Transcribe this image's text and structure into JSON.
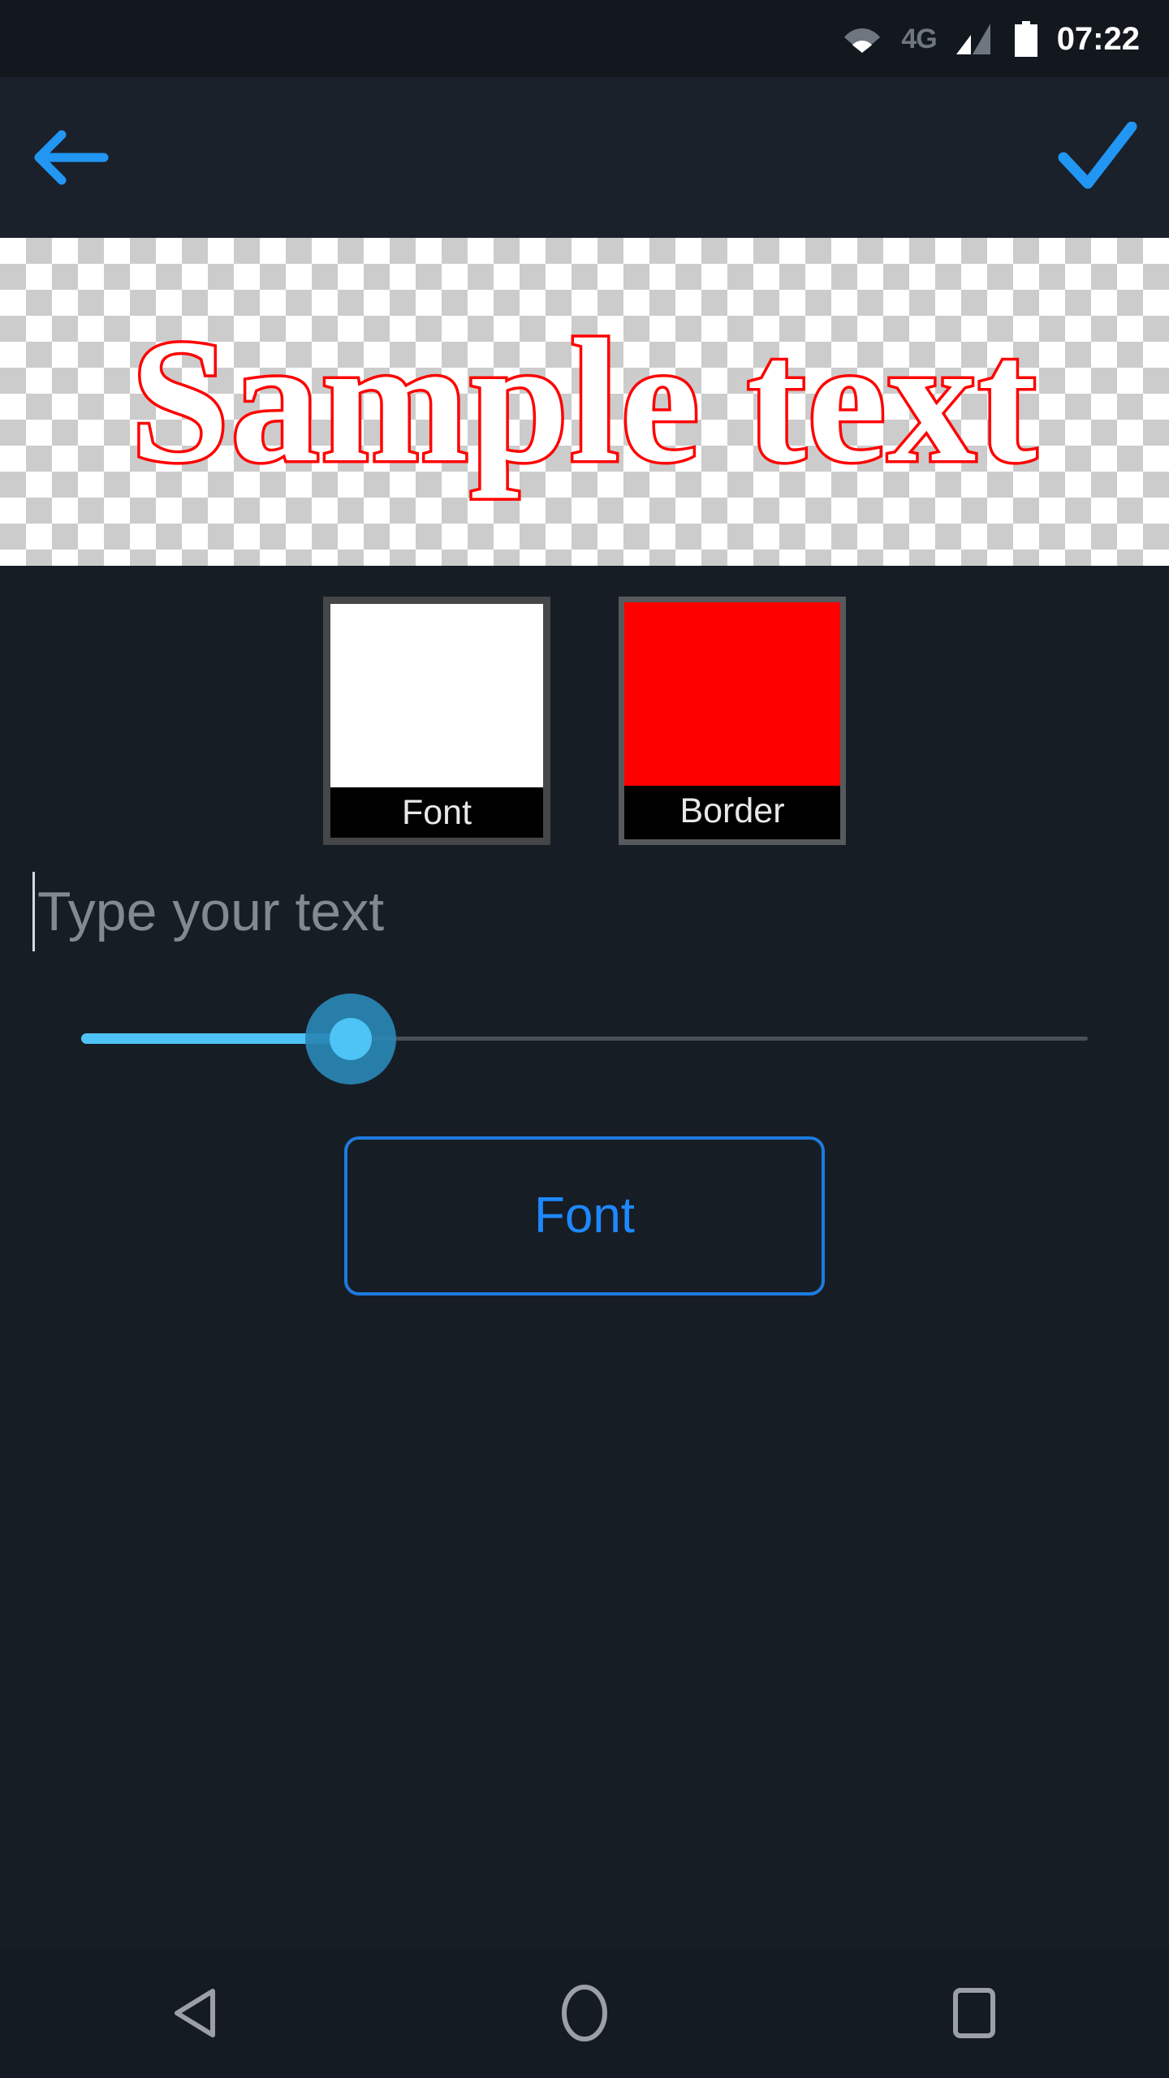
{
  "status_bar": {
    "wifi_icon": "wifi-icon",
    "network_type": "4G",
    "signal_icon": "signal-bars-icon",
    "battery_icon": "battery-full-icon",
    "clock": "07:22"
  },
  "toolbar": {
    "back_icon": "arrow-left-icon",
    "confirm_icon": "checkmark-icon",
    "accent_color": "#2196f3"
  },
  "preview": {
    "text": "Sample text",
    "fill_color": "#ffffff",
    "stroke_color": "#ff0000",
    "background": "transparency-checkerboard"
  },
  "swatches": [
    {
      "label": "Font",
      "color": "#ffffff",
      "name": "font-color-swatch"
    },
    {
      "label": "Border",
      "color": "#ff0000",
      "name": "border-color-swatch"
    }
  ],
  "text_field": {
    "value": "",
    "placeholder": "Type your text"
  },
  "slider": {
    "name": "text-size-slider",
    "value_fraction": 0.266,
    "active_color": "#4ec3f5",
    "inactive_color": "#4a5057"
  },
  "font_button": {
    "label": "Font",
    "border_color": "#1e7ae0",
    "text_color": "#1e88ff"
  },
  "nav_bar": {
    "back": "nav-back-icon",
    "home": "nav-home-icon",
    "recents": "nav-recents-icon"
  }
}
